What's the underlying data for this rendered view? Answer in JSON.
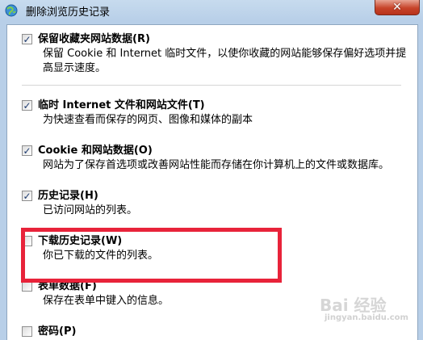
{
  "window": {
    "title": "删除浏览历史记录",
    "close_symbol": "✕"
  },
  "items": [
    {
      "label": "保留收藏夹网站数据(R)",
      "checked": true,
      "description": "保留 Cookie 和 Internet 临时文件，以使你收藏的网站能够保存偏好选项并提高显示速度。"
    },
    {
      "label": "临时 Internet 文件和网站文件(T)",
      "checked": true,
      "description": "为快速查看而保存的网页、图像和媒体的副本"
    },
    {
      "label": "Cookie 和网站数据(O)",
      "checked": true,
      "description": "网站为了保存首选项或改善网站性能而存储在你计算机上的文件或数据库。"
    },
    {
      "label": "历史记录(H)",
      "checked": true,
      "description": "已访问网站的列表。"
    },
    {
      "label": "下载历史记录(W)",
      "checked": false,
      "description": "你已下载的文件的列表。"
    },
    {
      "label": "表单数据(F)",
      "checked": false,
      "description": "保存在表单中键入的信息。"
    },
    {
      "label": "密码(P)",
      "checked": false,
      "description": ""
    }
  ],
  "watermark": {
    "text": "Bai 经验",
    "sub": "jingyan.baidu.com"
  },
  "colors": {
    "highlight_border": "#e8233a",
    "checkmark": "#1d3a6e"
  },
  "icons": {
    "title_icon": "ie-globe-icon",
    "checkmark": "checkmark-icon"
  }
}
